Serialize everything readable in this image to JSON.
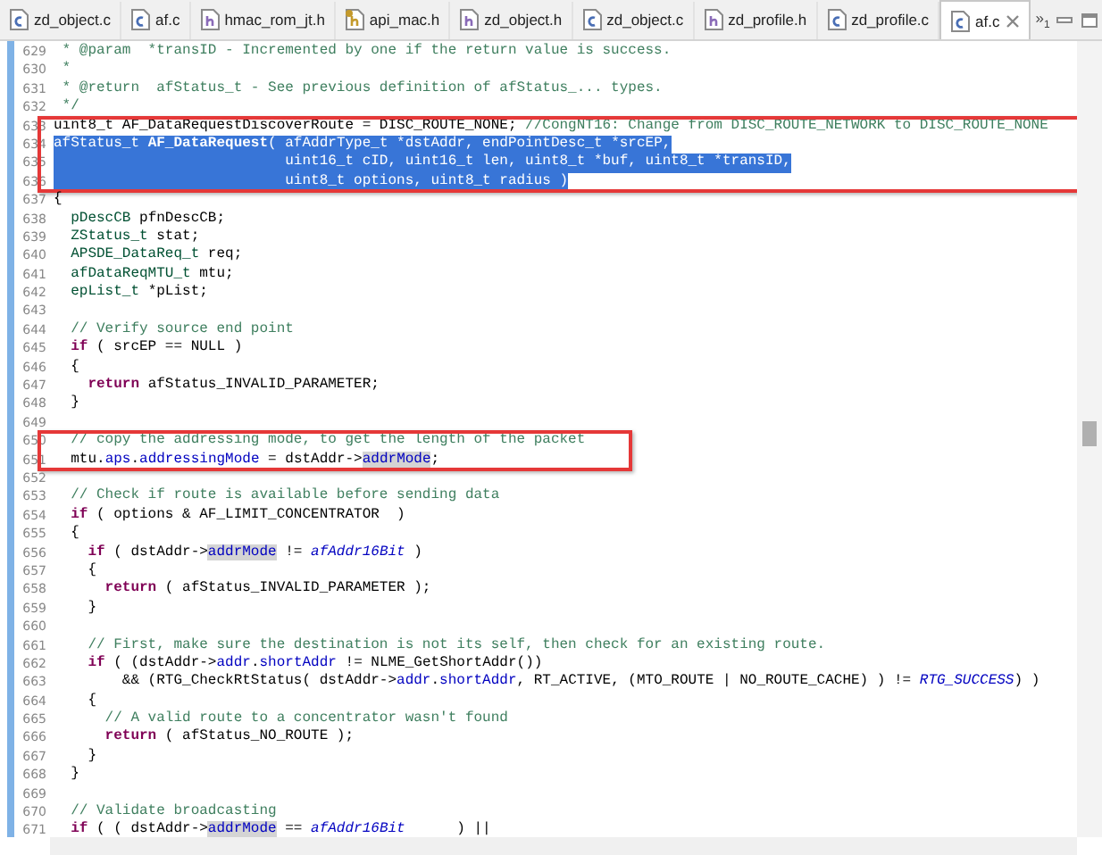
{
  "tabs": [
    {
      "label": "zd_object.c",
      "kind": "c",
      "selected": false
    },
    {
      "label": "af.c",
      "kind": "c",
      "selected": false
    },
    {
      "label": "hmac_rom_jt.h",
      "kind": "h",
      "selected": false
    },
    {
      "label": "api_mac.h",
      "kind": "hlib",
      "selected": false
    },
    {
      "label": "zd_object.h",
      "kind": "h",
      "selected": false
    },
    {
      "label": "zd_object.c",
      "kind": "c",
      "selected": false
    },
    {
      "label": "zd_profile.h",
      "kind": "h",
      "selected": false
    },
    {
      "label": "zd_profile.c",
      "kind": "c",
      "selected": false
    },
    {
      "label": "af.c",
      "kind": "c",
      "selected": true
    }
  ],
  "overflow": {
    "symbol": "»",
    "count": "1"
  },
  "segments": [
    {
      "boxed": false,
      "lines": [
        {
          "number": "629",
          "selected": false,
          "tokens": [
            {
              "text": " * @param  *transID - Incremented by one if the return value is success.",
              "kind": "comment"
            }
          ]
        },
        {
          "number": "630",
          "selected": false,
          "tokens": [
            {
              "text": " *",
              "kind": "comment"
            }
          ]
        },
        {
          "number": "631",
          "selected": false,
          "tokens": [
            {
              "text": " * @return  afStatus_t - See previous definition of afStatus_... types.",
              "kind": "comment"
            }
          ]
        },
        {
          "number": "632",
          "selected": false,
          "tokens": [
            {
              "text": " */",
              "kind": "comment"
            }
          ]
        }
      ]
    },
    {
      "boxed": true,
      "lines": [
        {
          "number": "633",
          "selected": false,
          "tokens": [
            {
              "text": "uint8_t AF_DataRequestDiscoverRoute = DISC_ROUTE_NONE; ",
              "kind": "plain"
            },
            {
              "text": "//CongNT16: Change from DISC_ROUTE_NETWORK to DISC_ROUTE_NONE",
              "kind": "comment"
            }
          ]
        },
        {
          "number": "634",
          "selected": true,
          "tokens": [
            {
              "text": "afStatus_t ",
              "kind": "plain"
            },
            {
              "text": "AF_DataRequest",
              "kind": "bold"
            },
            {
              "text": "( afAddrType_t *dstAddr, endPointDesc_t *srcEP,",
              "kind": "plain"
            }
          ]
        },
        {
          "number": "635",
          "selected": true,
          "tokens": [
            {
              "text": "                           uint16_t cID, uint16_t len, uint8_t *buf, uint8_t *transID,",
              "kind": "plain"
            }
          ]
        },
        {
          "number": "636",
          "selected": true,
          "tokens": [
            {
              "text": "                           uint8_t options, uint8_t radius )",
              "kind": "plain"
            }
          ]
        }
      ]
    },
    {
      "boxed": false,
      "lines": [
        {
          "number": "637",
          "selected": false,
          "tokens": [
            {
              "text": "{",
              "kind": "plain"
            }
          ]
        },
        {
          "number": "638",
          "selected": false,
          "tokens": [
            {
              "text": "  pDescCB",
              "kind": "type"
            },
            {
              "text": " pfnDescCB;",
              "kind": "plain"
            }
          ]
        },
        {
          "number": "639",
          "selected": false,
          "tokens": [
            {
              "text": "  ZStatus_t",
              "kind": "type"
            },
            {
              "text": " stat;",
              "kind": "plain"
            }
          ]
        },
        {
          "number": "640",
          "selected": false,
          "tokens": [
            {
              "text": "  APSDE_DataReq_t",
              "kind": "type"
            },
            {
              "text": " req;",
              "kind": "plain"
            }
          ]
        },
        {
          "number": "641",
          "selected": false,
          "tokens": [
            {
              "text": "  afDataReqMTU_t",
              "kind": "type"
            },
            {
              "text": " mtu;",
              "kind": "plain"
            }
          ]
        },
        {
          "number": "642",
          "selected": false,
          "tokens": [
            {
              "text": "  epList_t",
              "kind": "type"
            },
            {
              "text": " *pList;",
              "kind": "plain"
            }
          ]
        },
        {
          "number": "643",
          "selected": false
        },
        {
          "number": "644",
          "selected": false,
          "tokens": [
            {
              "text": "  // Verify source end point",
              "kind": "comment"
            }
          ]
        },
        {
          "number": "645",
          "selected": false,
          "tokens": [
            {
              "text": "  if",
              "kind": "keyword"
            },
            {
              "text": " ( srcEP == NULL )",
              "kind": "plain"
            }
          ]
        },
        {
          "number": "646",
          "selected": false,
          "tokens": [
            {
              "text": "  {",
              "kind": "plain"
            }
          ]
        },
        {
          "number": "647",
          "selected": false,
          "tokens": [
            {
              "text": "    return",
              "kind": "keyword"
            },
            {
              "text": " afStatus_INVALID_PARAMETER;",
              "kind": "plain"
            }
          ]
        },
        {
          "number": "648",
          "selected": false,
          "tokens": [
            {
              "text": "  }",
              "kind": "plain"
            }
          ]
        },
        {
          "number": "649",
          "selected": false
        }
      ]
    },
    {
      "boxed": true,
      "lines": [
        {
          "number": "650",
          "selected": false,
          "tokens": [
            {
              "text": "  // copy the addressing mode, to get the length of the packet",
              "kind": "comment"
            }
          ]
        },
        {
          "number": "651",
          "selected": false,
          "tokens": [
            {
              "text": "  mtu.",
              "kind": "plain"
            },
            {
              "text": "aps",
              "kind": "field"
            },
            {
              "text": ".",
              "kind": "plain"
            },
            {
              "text": "addressingMode",
              "kind": "field"
            },
            {
              "text": " = dstAddr->",
              "kind": "plain"
            },
            {
              "text": "addrMode",
              "kind": "occurrence"
            },
            {
              "text": ";",
              "kind": "plain"
            }
          ]
        }
      ]
    },
    {
      "boxed": false,
      "lines": [
        {
          "number": "652",
          "selected": false
        },
        {
          "number": "653",
          "selected": false,
          "tokens": [
            {
              "text": "  // Check if route is available before sending data",
              "kind": "comment"
            }
          ]
        },
        {
          "number": "654",
          "selected": false,
          "tokens": [
            {
              "text": "  if",
              "kind": "keyword"
            },
            {
              "text": " ( options & AF_LIMIT_CONCENTRATOR  )",
              "kind": "plain"
            }
          ]
        },
        {
          "number": "655",
          "selected": false,
          "tokens": [
            {
              "text": "  {",
              "kind": "plain"
            }
          ]
        },
        {
          "number": "656",
          "selected": false,
          "tokens": [
            {
              "text": "    if",
              "kind": "keyword"
            },
            {
              "text": " ( dstAddr->",
              "kind": "plain"
            },
            {
              "text": "addrMode",
              "kind": "occurrence"
            },
            {
              "text": " != ",
              "kind": "plain"
            },
            {
              "text": "afAddr16Bit",
              "kind": "enum"
            },
            {
              "text": " )",
              "kind": "plain"
            }
          ]
        },
        {
          "number": "657",
          "selected": false,
          "tokens": [
            {
              "text": "    {",
              "kind": "plain"
            }
          ]
        },
        {
          "number": "658",
          "selected": false,
          "tokens": [
            {
              "text": "      return",
              "kind": "keyword"
            },
            {
              "text": " ( afStatus_INVALID_PARAMETER );",
              "kind": "plain"
            }
          ]
        },
        {
          "number": "659",
          "selected": false,
          "tokens": [
            {
              "text": "    }",
              "kind": "plain"
            }
          ]
        },
        {
          "number": "660",
          "selected": false
        },
        {
          "number": "661",
          "selected": false,
          "tokens": [
            {
              "text": "    // First, make sure the destination is not its self, then check for an existing route.",
              "kind": "comment"
            }
          ]
        },
        {
          "number": "662",
          "selected": false,
          "tokens": [
            {
              "text": "    if",
              "kind": "keyword"
            },
            {
              "text": " ( (dstAddr->",
              "kind": "plain"
            },
            {
              "text": "addr",
              "kind": "field"
            },
            {
              "text": ".",
              "kind": "plain"
            },
            {
              "text": "shortAddr",
              "kind": "field"
            },
            {
              "text": " != NLME_GetShortAddr())",
              "kind": "plain"
            }
          ]
        },
        {
          "number": "663",
          "selected": false,
          "tokens": [
            {
              "text": "        && (RTG_CheckRtStatus( dstAddr->",
              "kind": "plain"
            },
            {
              "text": "addr",
              "kind": "field"
            },
            {
              "text": ".",
              "kind": "plain"
            },
            {
              "text": "shortAddr",
              "kind": "field"
            },
            {
              "text": ", RT_ACTIVE, (MTO_ROUTE | NO_ROUTE_CACHE) ) != ",
              "kind": "plain"
            },
            {
              "text": "RTG_SUCCESS",
              "kind": "enum"
            },
            {
              "text": ") )",
              "kind": "plain"
            }
          ]
        },
        {
          "number": "664",
          "selected": false,
          "tokens": [
            {
              "text": "    {",
              "kind": "plain"
            }
          ]
        },
        {
          "number": "665",
          "selected": false,
          "tokens": [
            {
              "text": "      // A valid route to a concentrator wasn't found",
              "kind": "comment"
            }
          ]
        },
        {
          "number": "666",
          "selected": false,
          "tokens": [
            {
              "text": "      return",
              "kind": "keyword"
            },
            {
              "text": " ( afStatus_NO_ROUTE );",
              "kind": "plain"
            }
          ]
        },
        {
          "number": "667",
          "selected": false,
          "tokens": [
            {
              "text": "    }",
              "kind": "plain"
            }
          ]
        },
        {
          "number": "668",
          "selected": false,
          "tokens": [
            {
              "text": "  }",
              "kind": "plain"
            }
          ]
        },
        {
          "number": "669",
          "selected": false
        },
        {
          "number": "670",
          "selected": false,
          "tokens": [
            {
              "text": "  // Validate broadcasting",
              "kind": "comment"
            }
          ]
        },
        {
          "number": "671",
          "selected": false,
          "tokens": [
            {
              "text": "  if",
              "kind": "keyword"
            },
            {
              "text": " ( ( dstAddr->",
              "kind": "plain"
            },
            {
              "text": "addrMode",
              "kind": "occurrence"
            },
            {
              "text": " == ",
              "kind": "plain"
            },
            {
              "text": "afAddr16Bit",
              "kind": "enum"
            },
            {
              "text": "      ) ||",
              "kind": "plain"
            }
          ]
        }
      ]
    }
  ]
}
